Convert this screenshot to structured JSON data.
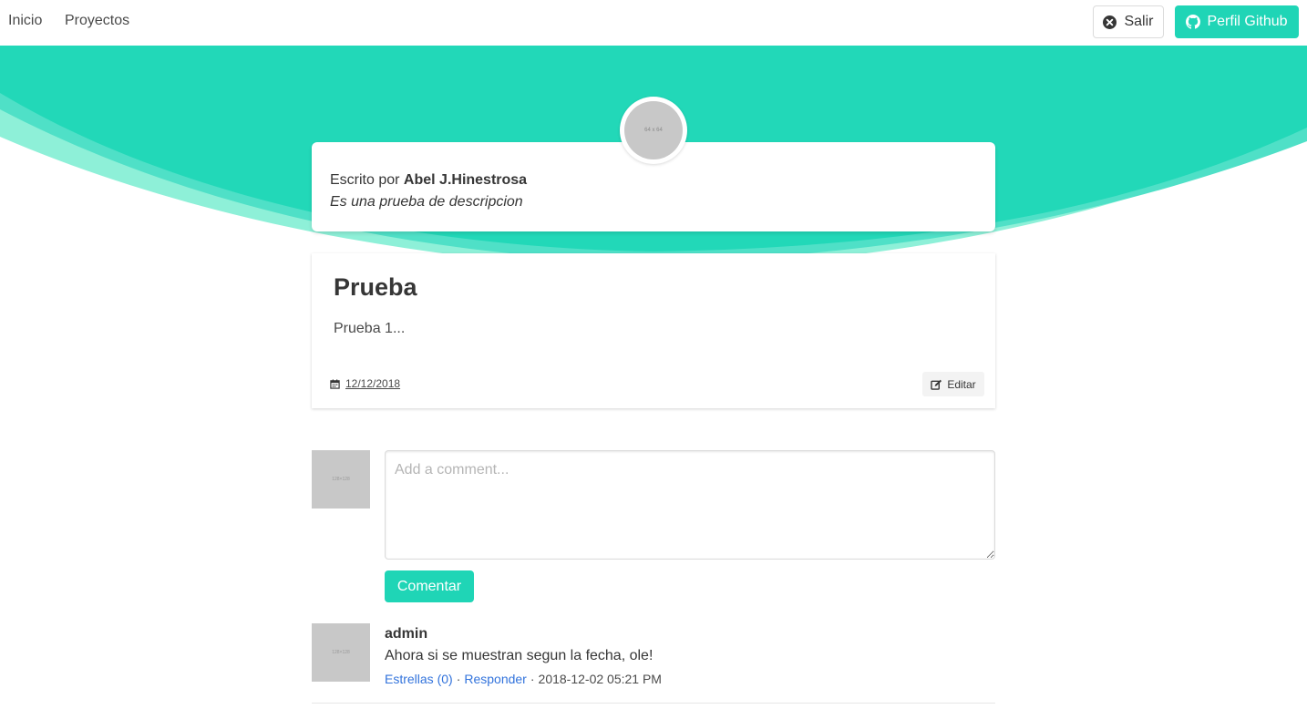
{
  "navbar": {
    "links": [
      "Inicio",
      "Proyectos"
    ],
    "logout_label": "Salir",
    "github_label": "Perfil Github"
  },
  "author": {
    "avatar_text": "64 x 64",
    "written_by": "Escrito por",
    "name": "Abel J.Hinestrosa",
    "description": "Es una prueba de descripcion"
  },
  "post": {
    "title": "Prueba",
    "body": "Prueba 1...",
    "date": "12/12/2018",
    "edit_label": "Editar"
  },
  "comment_form": {
    "avatar_text": "128×128",
    "placeholder": "Add a comment...",
    "submit_label": "Comentar"
  },
  "comments": [
    {
      "avatar_text": "128×128",
      "author": "admin",
      "text": "Ahora si se muestran segun la fecha, ole!",
      "stars_label": "Estrellas (0)",
      "reply_label": "Responder",
      "separator": "·",
      "timestamp": "2018-12-02 05:21 PM"
    }
  ],
  "colors": {
    "primary": "#1fd5b6",
    "link": "#3273dc",
    "hero_light": "#8ef0d8",
    "hero_mid": "#4fe0c7"
  }
}
